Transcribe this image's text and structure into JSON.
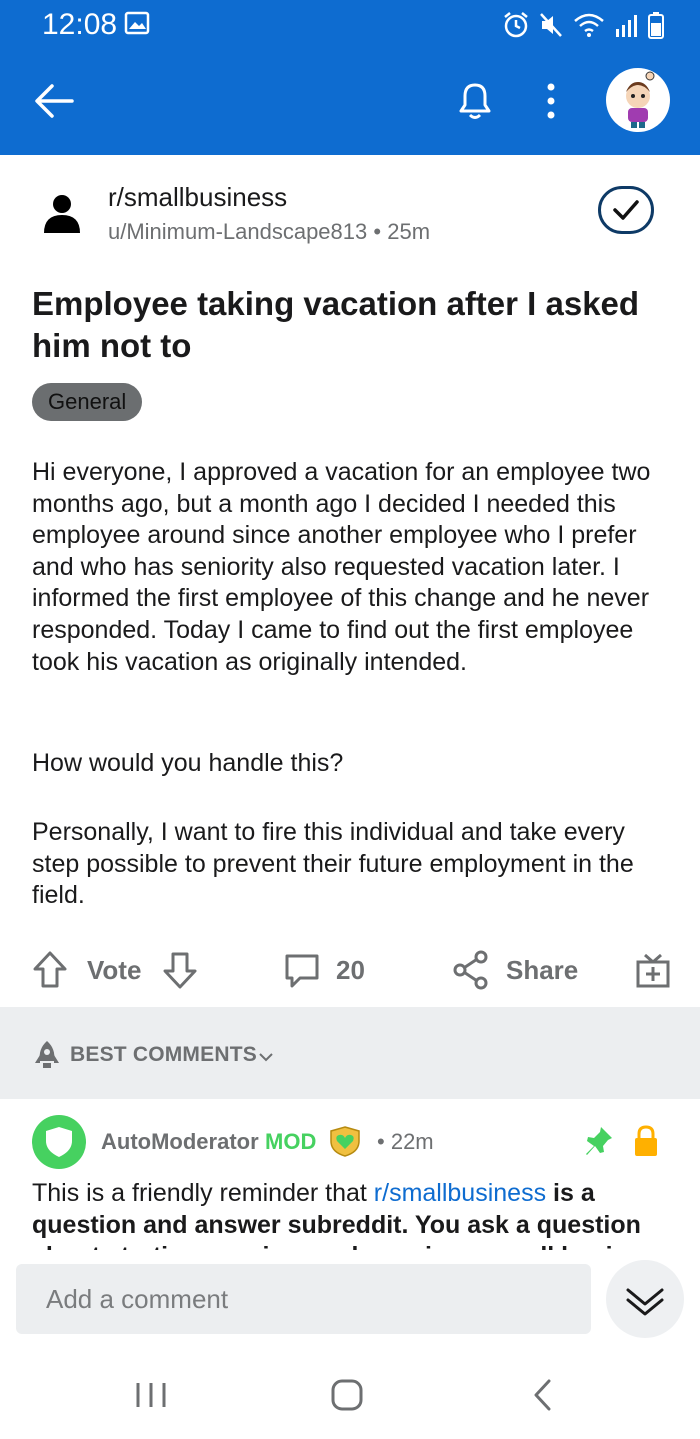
{
  "status_bar": {
    "time": "12:08"
  },
  "app_bar": {
    "back_icon": "arrow-left-icon",
    "notifications_icon": "bell-icon",
    "more_icon": "vertical-dots-icon"
  },
  "post": {
    "subreddit": "r/smallbusiness",
    "author": "u/Minimum-Landscape813",
    "age": "25m",
    "byline_sep": "•",
    "title": "Employee taking vacation after I asked him not to",
    "flair": "General",
    "body_paragraphs": [
      "Hi everyone, I approved a vacation for an employee two months ago, but a month ago I decided I needed this employee around since another employee who I prefer and who has seniority also requested vacation later. I informed the first employee of this change and he never responded. Today I came to find out the first employee took his vacation as originally intended.",
      "How would you handle this?",
      "Personally, I want to fire this individual and take every step possible to prevent their future employment in the field."
    ]
  },
  "actions": {
    "vote_label": "Vote",
    "comment_count": "20",
    "share_label": "Share"
  },
  "comments_sort": {
    "label": "BEST COMMENTS"
  },
  "comment": {
    "author": "AutoModerator",
    "mod_tag": "MOD",
    "time_sep": "•",
    "time": "22m",
    "text_prefix": "This is a friendly reminder that ",
    "text_link": "r/smallbusiness",
    "text_rest": " is a question and answer subreddit. You ask a question about starting, owning, and growing a small business"
  },
  "compose": {
    "placeholder": "Add a comment"
  },
  "colors": {
    "app_bar": "#0e6cd0",
    "mod_green": "#46d160",
    "meta_gray": "#6d6f71",
    "lock_yellow": "#ffb000"
  }
}
